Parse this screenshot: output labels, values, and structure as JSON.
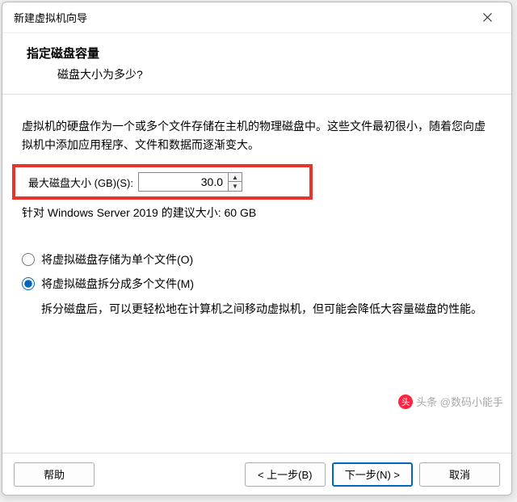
{
  "titlebar": {
    "title": "新建虚拟机向导"
  },
  "header": {
    "title": "指定磁盘容量",
    "subtitle": "磁盘大小为多少?"
  },
  "content": {
    "description": "虚拟机的硬盘作为一个或多个文件存储在主机的物理磁盘中。这些文件最初很小，随着您向虚拟机中添加应用程序、文件和数据而逐渐变大。",
    "disk_label": "最大磁盘大小 (GB)(S):",
    "disk_value": "30.0",
    "recommendation": "针对 Windows Server 2019 的建议大小: 60 GB",
    "radio_single": "将虚拟磁盘存储为单个文件(O)",
    "radio_split": "将虚拟磁盘拆分成多个文件(M)",
    "split_desc": "拆分磁盘后，可以更轻松地在计算机之间移动虚拟机，但可能会降低大容量磁盘的性能。"
  },
  "footer": {
    "help": "帮助",
    "back": "< 上一步(B)",
    "next": "下一步(N) >",
    "cancel": "取消"
  },
  "watermark": {
    "text": "头条 @数码小能手"
  }
}
